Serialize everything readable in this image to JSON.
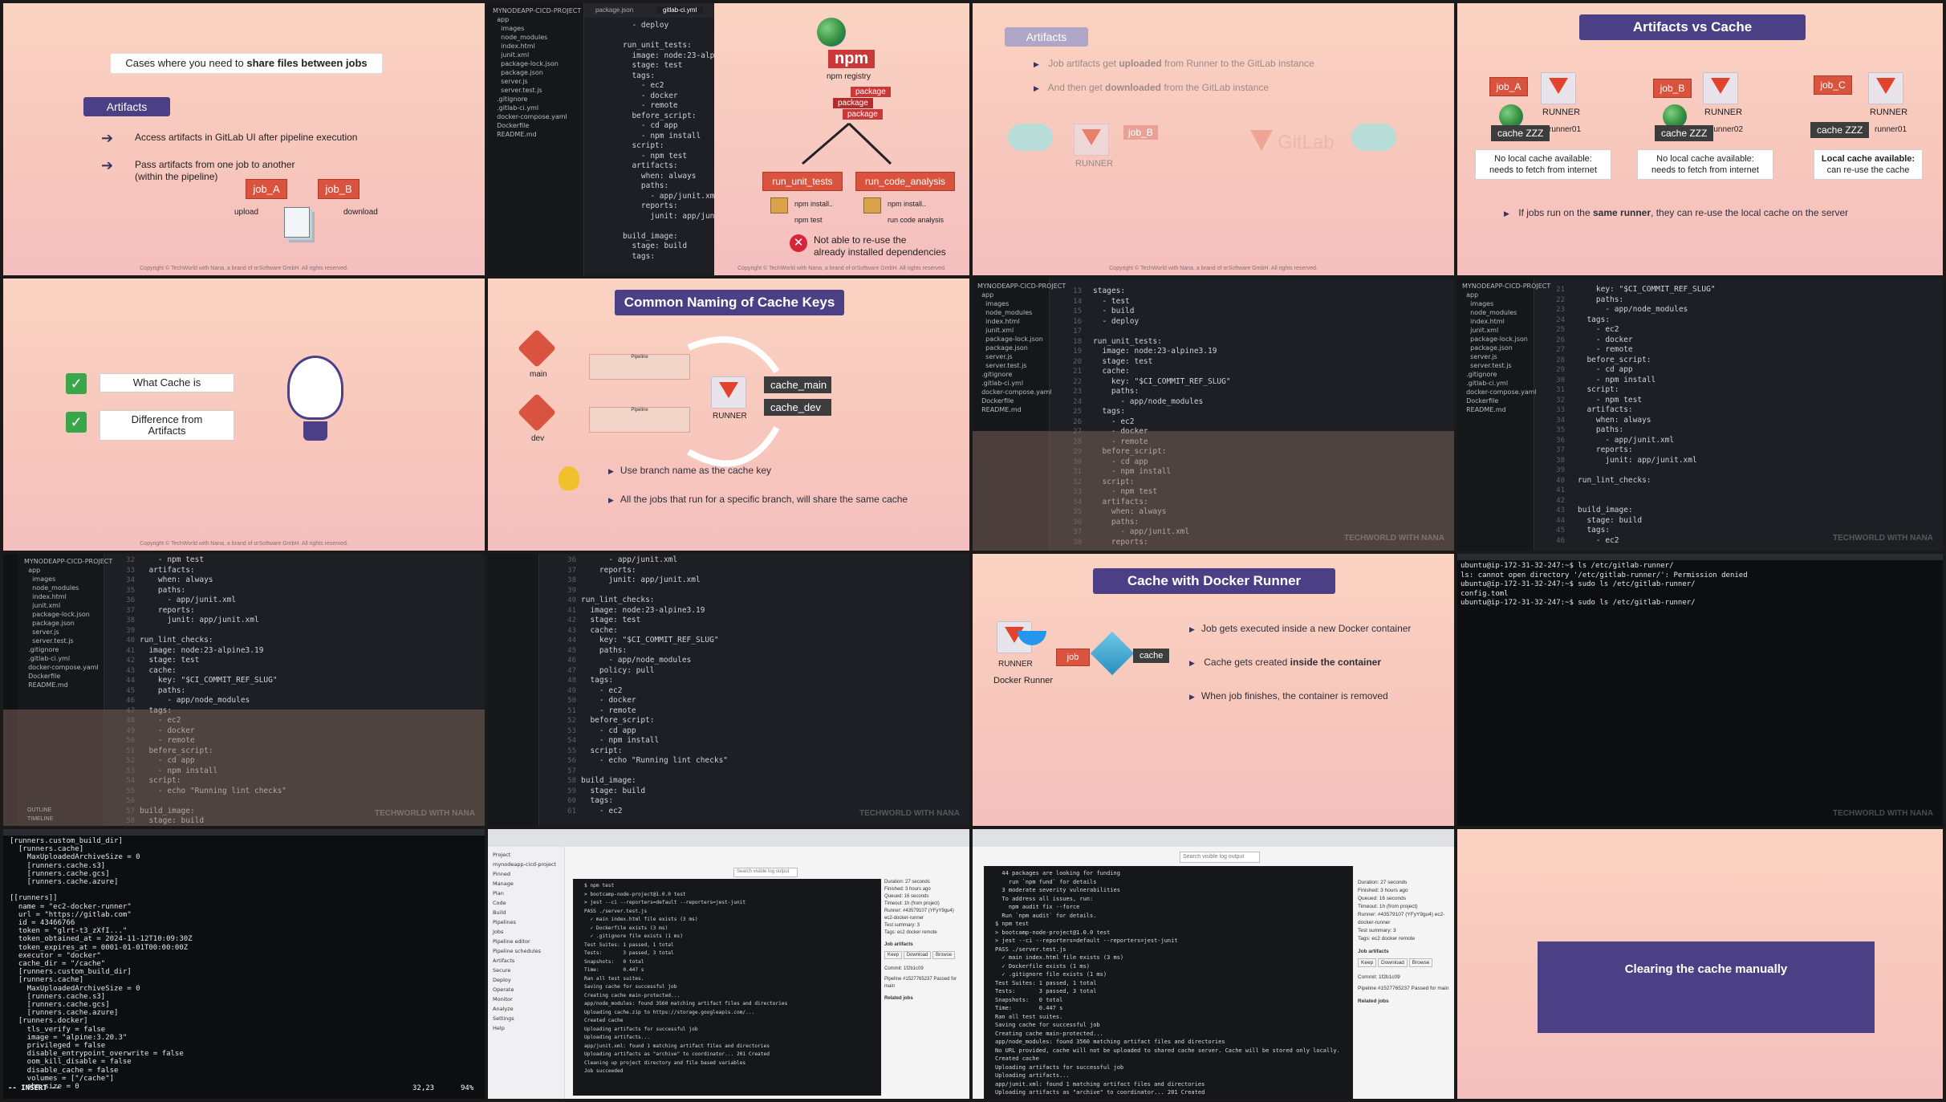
{
  "copyright": "Copyright © TechWorld with Nana, a brand of orSoftware GmbH. All rights reserved.",
  "watermark": "TECHWORLD WITH NANA",
  "t1": {
    "headline_pre": "Cases where you need to ",
    "headline_bold": "share files between jobs",
    "pill": "Artifacts",
    "b1": "Access artifacts in GitLab UI after pipeline execution",
    "b2a": "Pass artifacts from one job to another",
    "b2b": "(within the pipeline)",
    "job_a": "job_A",
    "job_b": "job_B",
    "upload": "upload",
    "download": "download"
  },
  "t2": {
    "explorer": "EXPLORER",
    "tab1": "package.json",
    "tab2": "gitlab-ci.yml",
    "tree": [
      "MYNODEAPP-CICD-PROJECT",
      "  app",
      "    images",
      "    node_modules",
      "    index.html",
      "    junit.xml",
      "    package-lock.json",
      "    package.json",
      "    server.js",
      "    server.test.js",
      "  .gitignore",
      "  .gitlab-ci.yml",
      "  docker-compose.yaml",
      "  Dockerfile",
      "  README.md"
    ],
    "code": [
      "  - deploy",
      "",
      "run_unit_tests:",
      "  image: node:23-alpine3",
      "  stage: test",
      "  tags:",
      "    - ec2",
      "    - docker",
      "    - remote",
      "  before_script:",
      "    - cd app",
      "    - npm install",
      "  script:",
      "    - npm test",
      "  artifacts:",
      "    when: always",
      "    paths:",
      "      - app/junit.xml",
      "    reports:",
      "      junit: app/junit.x",
      "",
      "build_image:",
      "  stage: build",
      "  tags:"
    ],
    "registry": "npm registry",
    "npm": "npm",
    "package": "package",
    "job1": "run_unit_tests",
    "job2": "run_code_analysis",
    "install1": "npm install..",
    "install2": "npm install..",
    "run1": "npm test",
    "run2": "run code analysis",
    "warn1": "Not able to re-use the",
    "warn2": "already installed dependencies"
  },
  "t3": {
    "pill": "Artifacts",
    "b1_pre": "Job artifacts get ",
    "b1_bold": "uploaded",
    "b1_post": " from Runner to the GitLab instance",
    "b2_pre": "And then get ",
    "b2_bold": "downloaded",
    "b2_post": " from the GitLab instance",
    "runner": "RUNNER",
    "job_b": "job_B",
    "gitlab": "GitLab"
  },
  "t4": {
    "title": "Artifacts vs Cache",
    "job_a": "job_A",
    "job_b": "job_B",
    "job_c": "job_C",
    "runner": "RUNNER",
    "cache": "cache ZZZ",
    "r1": "runner01",
    "r2": "runner02",
    "r3": "runner01",
    "box1a": "No local cache available:",
    "box1b": "needs to fetch from internet",
    "box2a": "No local cache available:",
    "box2b": "needs to fetch from internet",
    "box3a": "Local cache available:",
    "box3b": "can re-use the cache",
    "bottom_pre": "If jobs run on the ",
    "bottom_bold": "same runner",
    "bottom_post": ", they can re-use the local cache on the server"
  },
  "t5": {
    "item1": "What Cache is",
    "item2a": "Difference from",
    "item2b": "Artifacts"
  },
  "t6": {
    "title": "Common Naming of Cache Keys",
    "main": "main",
    "dev": "dev",
    "pipeline": "Pipeline",
    "runner": "RUNNER",
    "key1": "cache_main",
    "key2": "cache_dev",
    "b1": "Use branch name as the cache key",
    "b2": "All the jobs that run for a specific branch, will share the same cache"
  },
  "t7": {
    "code": [
      "stages:",
      "  - test",
      "  - build",
      "  - deploy",
      "",
      "run_unit_tests:",
      "  image: node:23-alpine3.19",
      "  stage: test",
      "  cache:",
      "    key: \"$CI_COMMIT_REF_SLUG\"",
      "    paths:",
      "      - app/node_modules",
      "  tags:",
      "    - ec2",
      "    - docker",
      "    - remote",
      "  before_script:",
      "    - cd app",
      "    - npm install",
      "  script:",
      "    - npm test",
      "  artifacts:",
      "    when: always",
      "    paths:",
      "      - app/junit.xml",
      "    reports:"
    ]
  },
  "t8": {
    "code": [
      "    key: \"$CI_COMMIT_REF_SLUG\"",
      "    paths:",
      "      - app/node_modules",
      "  tags:",
      "    - ec2",
      "    - docker",
      "    - remote",
      "  before_script:",
      "    - cd app",
      "    - npm install",
      "  script:",
      "    - npm test",
      "  artifacts:",
      "    when: always",
      "    paths:",
      "      - app/junit.xml",
      "    reports:",
      "      junit: app/junit.xml",
      "",
      "run_lint_checks:",
      "",
      "",
      "build_image:",
      "  stage: build",
      "  tags:",
      "    - ec2"
    ]
  },
  "t9": {
    "code": [
      "    - npm test",
      "  artifacts:",
      "    when: always",
      "    paths:",
      "      - app/junit.xml",
      "    reports:",
      "      junit: app/junit.xml",
      "",
      "run_lint_checks:",
      "  image: node:23-alpine3.19",
      "  stage: test",
      "  cache:",
      "    key: \"$CI_COMMIT_REF_SLUG\"",
      "    paths:",
      "      - app/node_modules",
      "  tags:",
      "    - ec2",
      "    - docker",
      "    - remote",
      "  before_script:",
      "    - cd app",
      "    - npm install",
      "  script:",
      "    - echo \"Running lint checks\"",
      "",
      "build_image:",
      "  stage: build",
      "  tags:"
    ],
    "outline": "OUTLINE",
    "timeline": "TIMELINE"
  },
  "t10": {
    "code": [
      "      - app/junit.xml",
      "    reports:",
      "      junit: app/junit.xml",
      "",
      "run_lint_checks:",
      "  image: node:23-alpine3.19",
      "  stage: test",
      "  cache:",
      "    key: \"$CI_COMMIT_REF_SLUG\"",
      "    paths:",
      "      - app/node_modules",
      "    policy: pull",
      "  tags:",
      "    - ec2",
      "    - docker",
      "    - remote",
      "  before_script:",
      "    - cd app",
      "    - npm install",
      "  script:",
      "    - echo \"Running lint checks\"",
      "",
      "build_image:",
      "  stage: build",
      "  tags:",
      "    - ec2"
    ]
  },
  "t11": {
    "title": "Cache with Docker Runner",
    "b1": "Job gets executed inside a new Docker container",
    "b2_pre": "Cache gets created ",
    "b2_bold": "inside the container",
    "b3": "When job finishes, the container is removed",
    "runner": "RUNNER",
    "docker_runner": "Docker Runner",
    "job": "job",
    "cache": "cache"
  },
  "t12": {
    "lines": [
      "ubuntu@ip-172-31-32-247:~$ ls /etc/gitlab-runner/",
      "ls: cannot open directory '/etc/gitlab-runner/': Permission denied",
      "ubuntu@ip-172-31-32-247:~$ sudo ls /etc/gitlab-runner/",
      "config.toml",
      "ubuntu@ip-172-31-32-247:~$ sudo ls /etc/gitlab-runner/"
    ]
  },
  "t13": {
    "lines": [
      "[runners.custom_build_dir]",
      "  [runners.cache]",
      "    MaxUploadedArchiveSize = 0",
      "    [runners.cache.s3]",
      "    [runners.cache.gcs]",
      "    [runners.cache.azure]",
      "",
      "[[runners]]",
      "  name = \"ec2-docker-runner\"",
      "  url = \"https://gitlab.com\"",
      "  id = 43466766",
      "  token = \"glrt-t3_zXfI...\"",
      "  token_obtained_at = 2024-11-12T10:09:30Z",
      "  token_expires_at = 0001-01-01T00:00:00Z",
      "  executor = \"docker\"",
      "  cache_dir = \"/cache\"",
      "  [runners.custom_build_dir]",
      "  [runners.cache]",
      "    MaxUploadedArchiveSize = 0",
      "    [runners.cache.s3]",
      "    [runners.cache.gcs]",
      "    [runners.cache.azure]",
      "  [runners.docker]",
      "    tls_verify = false",
      "    image = \"alpine:3.20.3\"",
      "    privileged = false",
      "    disable_entrypoint_overwrite = false",
      "    oom_kill_disable = false",
      "    disable_cache = false",
      "    volumes = [\"/cache\"]",
      "    shm_size = 0"
    ],
    "mode": "-- INSERT --",
    "pos": "32,23",
    "pct": "94%"
  },
  "t14": {
    "sidebar": [
      "Project",
      "mynodeapp-cicd-project",
      "Pinned",
      "Manage",
      "Plan",
      "Code",
      "Build",
      "Pipelines",
      "Jobs",
      "Pipeline editor",
      "Pipeline schedules",
      "Artifacts",
      "Secure",
      "Deploy",
      "Operate",
      "Monitor",
      "Analyze",
      "Settings",
      "Help"
    ],
    "log": [
      "$ npm test",
      "> bootcamp-node-project@1.0.0 test",
      "> jest --ci --reporters=default --reporters=jest-junit",
      "PASS ./server.test.js",
      "  ✓ main index.html file exists (3 ms)",
      "  ✓ Dockerfile exists (3 ms)",
      "  ✓ .gitignore file exists (1 ms)",
      "Test Suites: 1 passed, 1 total",
      "Tests:       3 passed, 3 total",
      "Snapshots:   0 total",
      "Time:        0.447 s",
      "Ran all test suites.",
      "Saving cache for successful job",
      "Creating cache main-protected...",
      "app/node_modules: found 3560 matching artifact files and directories",
      "Uploading cache.zip to https://storage.googleapis.com/...",
      "Created cache",
      "Uploading artifacts for successful job",
      "Uploading artifacts...",
      "app/junit.xml: found 1 matching artifact files and directories",
      "Uploading artifacts as \"archive\" to coordinator... 201 Created",
      "Cleaning up project directory and file based variables",
      "Job succeeded"
    ],
    "search": "Search visible log output",
    "duration": "Duration: 27 seconds",
    "finished": "Finished: 3 hours ago",
    "queued": "Queued: 16 seconds",
    "timeout": "Timeout: 1h (from project)",
    "runner": "Runner: #43579107 (YFyY9gu4) ec2-docker-runner",
    "summary": "Test summary: 3",
    "tags": "Tags: ec2 docker remote",
    "artifacts": "Job artifacts",
    "keep": "Keep",
    "download": "Download",
    "browse": "Browse",
    "commit": "Commit: 1f2b1c09",
    "pipeline": "Pipeline #1527765237 Passed for main",
    "related": "Related jobs"
  },
  "t15": {
    "log": [
      "  44 packages are looking for funding",
      "    run `npm fund` for details",
      "  3 moderate severity vulnerabilities",
      "  To address all issues, run:",
      "    npm audit fix --force",
      "  Run `npm audit` for details.",
      "$ npm test",
      "> bootcamp-node-project@1.0.0 test",
      "> jest --ci --reporters=default --reporters=jest-junit",
      "PASS ./server.test.js",
      "  ✓ main index.html file exists (3 ms)",
      "  ✓ Dockerfile exists (1 ms)",
      "  ✓ .gitignore file exists (1 ms)",
      "Test Suites: 1 passed, 1 total",
      "Tests:       3 passed, 3 total",
      "Snapshots:   0 total",
      "Time:        0.447 s",
      "Ran all test suites.",
      "Saving cache for successful job",
      "Creating cache main-protected...",
      "app/node_modules: found 3560 matching artifact files and directories",
      "No URL provided, cache will not be uploaded to shared cache server. Cache will be stored only locally.",
      "Created cache",
      "Uploading artifacts for successful job",
      "Uploading artifacts...",
      "app/junit.xml: found 1 matching artifact files and directories",
      "Uploading artifacts as \"archive\" to coordinator... 201 Created"
    ],
    "search": "Search visible log output",
    "duration": "Duration: 27 seconds",
    "finished": "Finished: 3 hours ago",
    "queued": "Queued: 16 seconds",
    "timeout": "Timeout: 1h (from project)",
    "runner": "Runner: #43579107 (YFyY9gu4) ec2-docker-runner",
    "summary": "Test summary: 3",
    "tags": "Tags: ec2 docker remote",
    "artifacts": "Job artifacts",
    "keep": "Keep",
    "download": "Download",
    "browse": "Browse",
    "commit": "Commit: 1f2b1c09",
    "pipeline": "Pipeline #1527765237 Passed for main",
    "related": "Related jobs"
  },
  "t16": {
    "title": "Clearing the cache manually"
  }
}
